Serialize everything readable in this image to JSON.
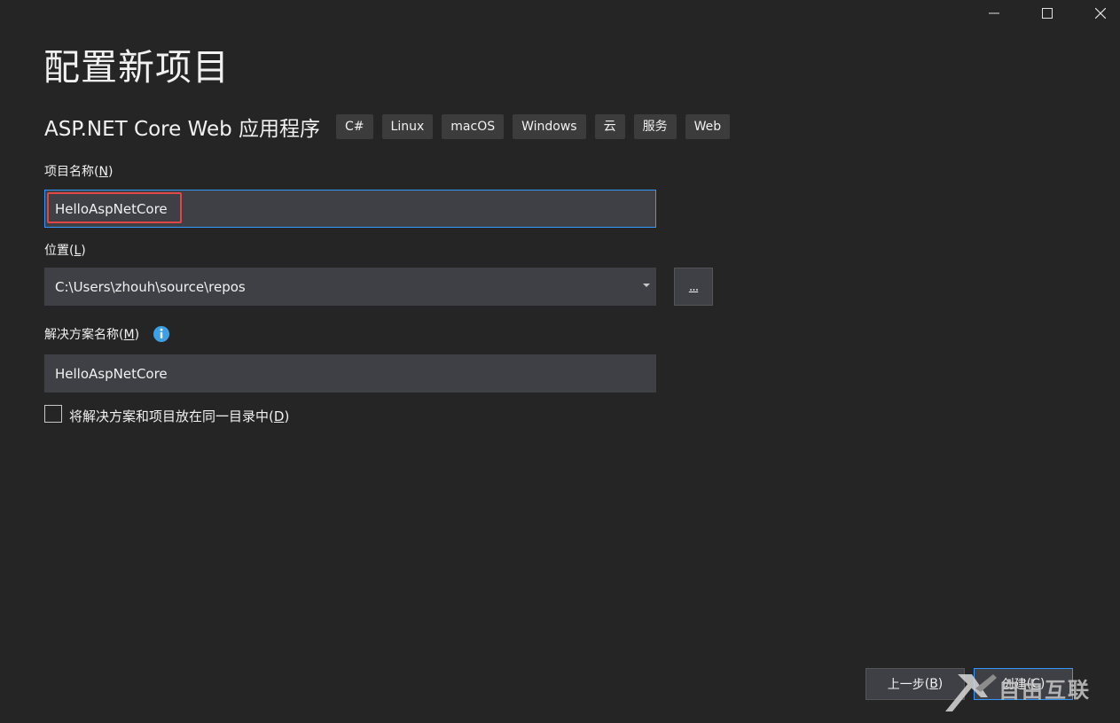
{
  "window_controls": {
    "minimize": "minimize",
    "maximize": "maximize",
    "close": "close"
  },
  "page_title": "配置新项目",
  "template": {
    "name": "ASP.NET Core Web 应用程序",
    "tags": [
      "C#",
      "Linux",
      "macOS",
      "Windows",
      "云",
      "服务",
      "Web"
    ]
  },
  "project_name": {
    "label": "项目名称",
    "accel": "N",
    "value": "HelloAspNetCore"
  },
  "location": {
    "label": "位置",
    "accel": "L",
    "value": "C:\\Users\\zhouh\\source\\repos",
    "browse_label": "..."
  },
  "solution_name": {
    "label": "解决方案名称",
    "accel": "M",
    "value": "HelloAspNetCore"
  },
  "same_dir": {
    "label": "将解决方案和项目放在同一目录中",
    "accel": "D",
    "checked": false
  },
  "footer": {
    "back_label": "上一步",
    "back_accel": "B",
    "create_label": "创建",
    "create_accel": "C"
  },
  "watermark": {
    "text": "自由互联"
  },
  "colors": {
    "background": "#252526",
    "input_bg": "#3f3f46",
    "focus_border": "#3399ff",
    "highlight": "#e04848",
    "info": "#3ba0e6"
  }
}
